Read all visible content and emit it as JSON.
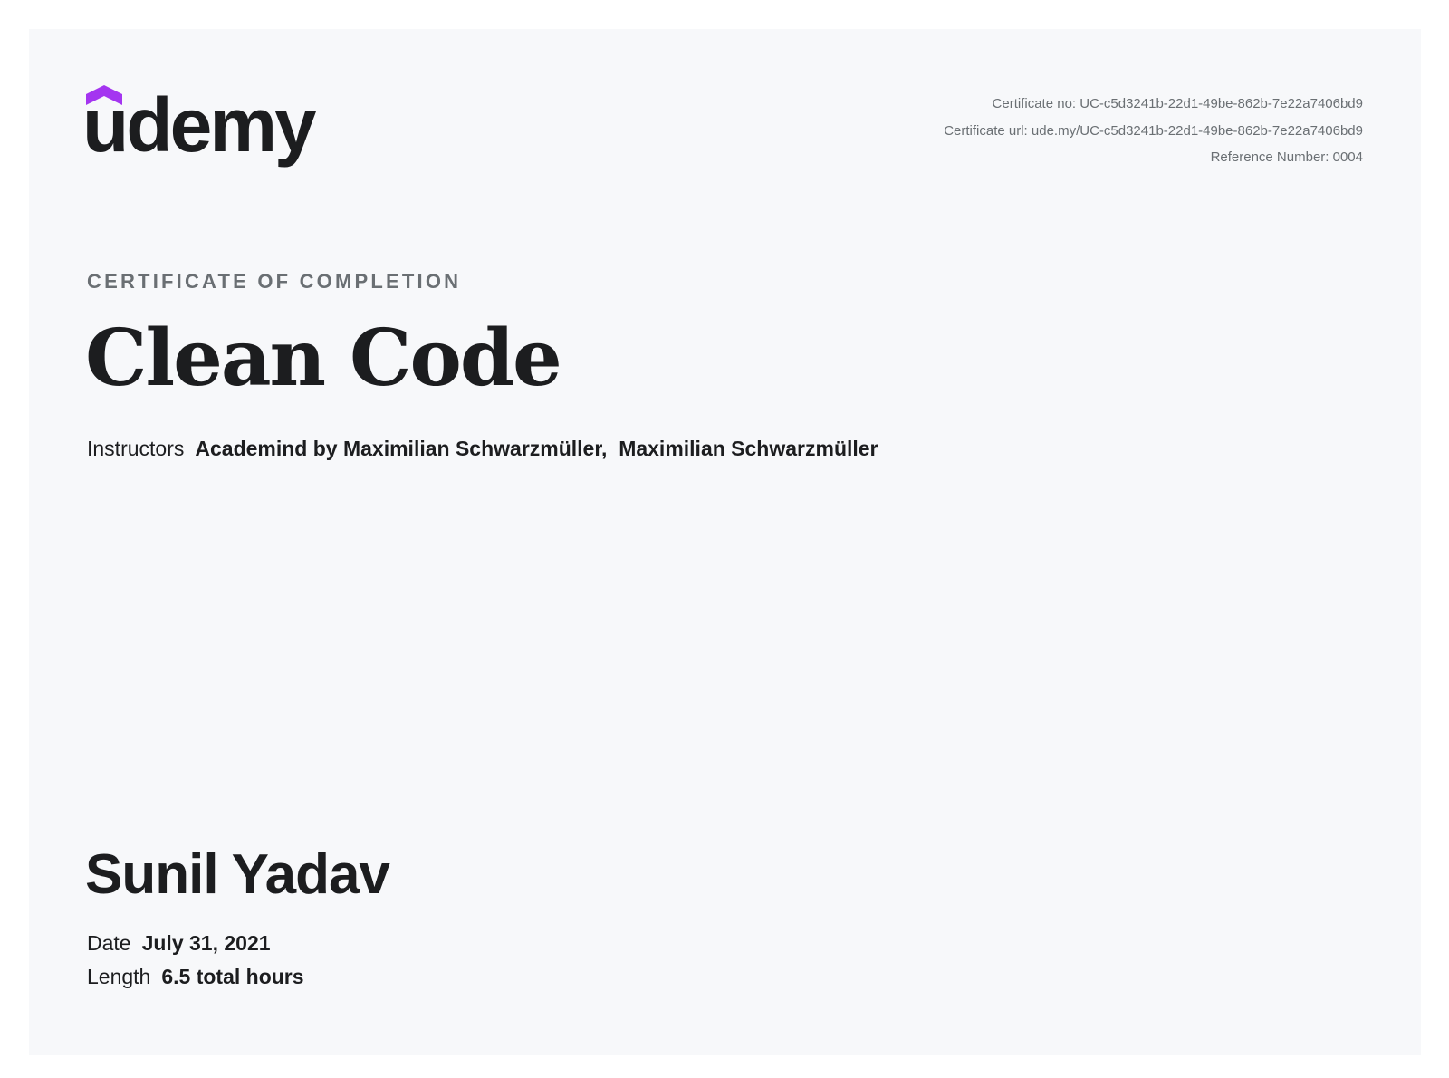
{
  "brand": {
    "logo_text": "udemy",
    "accent_color": "#a435f0",
    "icon": "udemy-logo-icon"
  },
  "meta": {
    "certificate_no": "Certificate no: UC-c5d3241b-22d1-49be-862b-7e22a7406bd9",
    "certificate_url": "Certificate url: ude.my/UC-c5d3241b-22d1-49be-862b-7e22a7406bd9",
    "reference_number": "Reference Number: 0004"
  },
  "certificate": {
    "kicker": "CERTIFICATE OF COMPLETION",
    "course_title": "Clean Code",
    "instructors_label": "Instructors",
    "instructors_value": "Academind by Maximilian Schwarzmüller,  Maximilian Schwarzmüller",
    "recipient": "Sunil Yadav",
    "date_label": "Date",
    "date_value": "July 31, 2021",
    "length_label": "Length",
    "length_value": "6.5 total hours"
  }
}
